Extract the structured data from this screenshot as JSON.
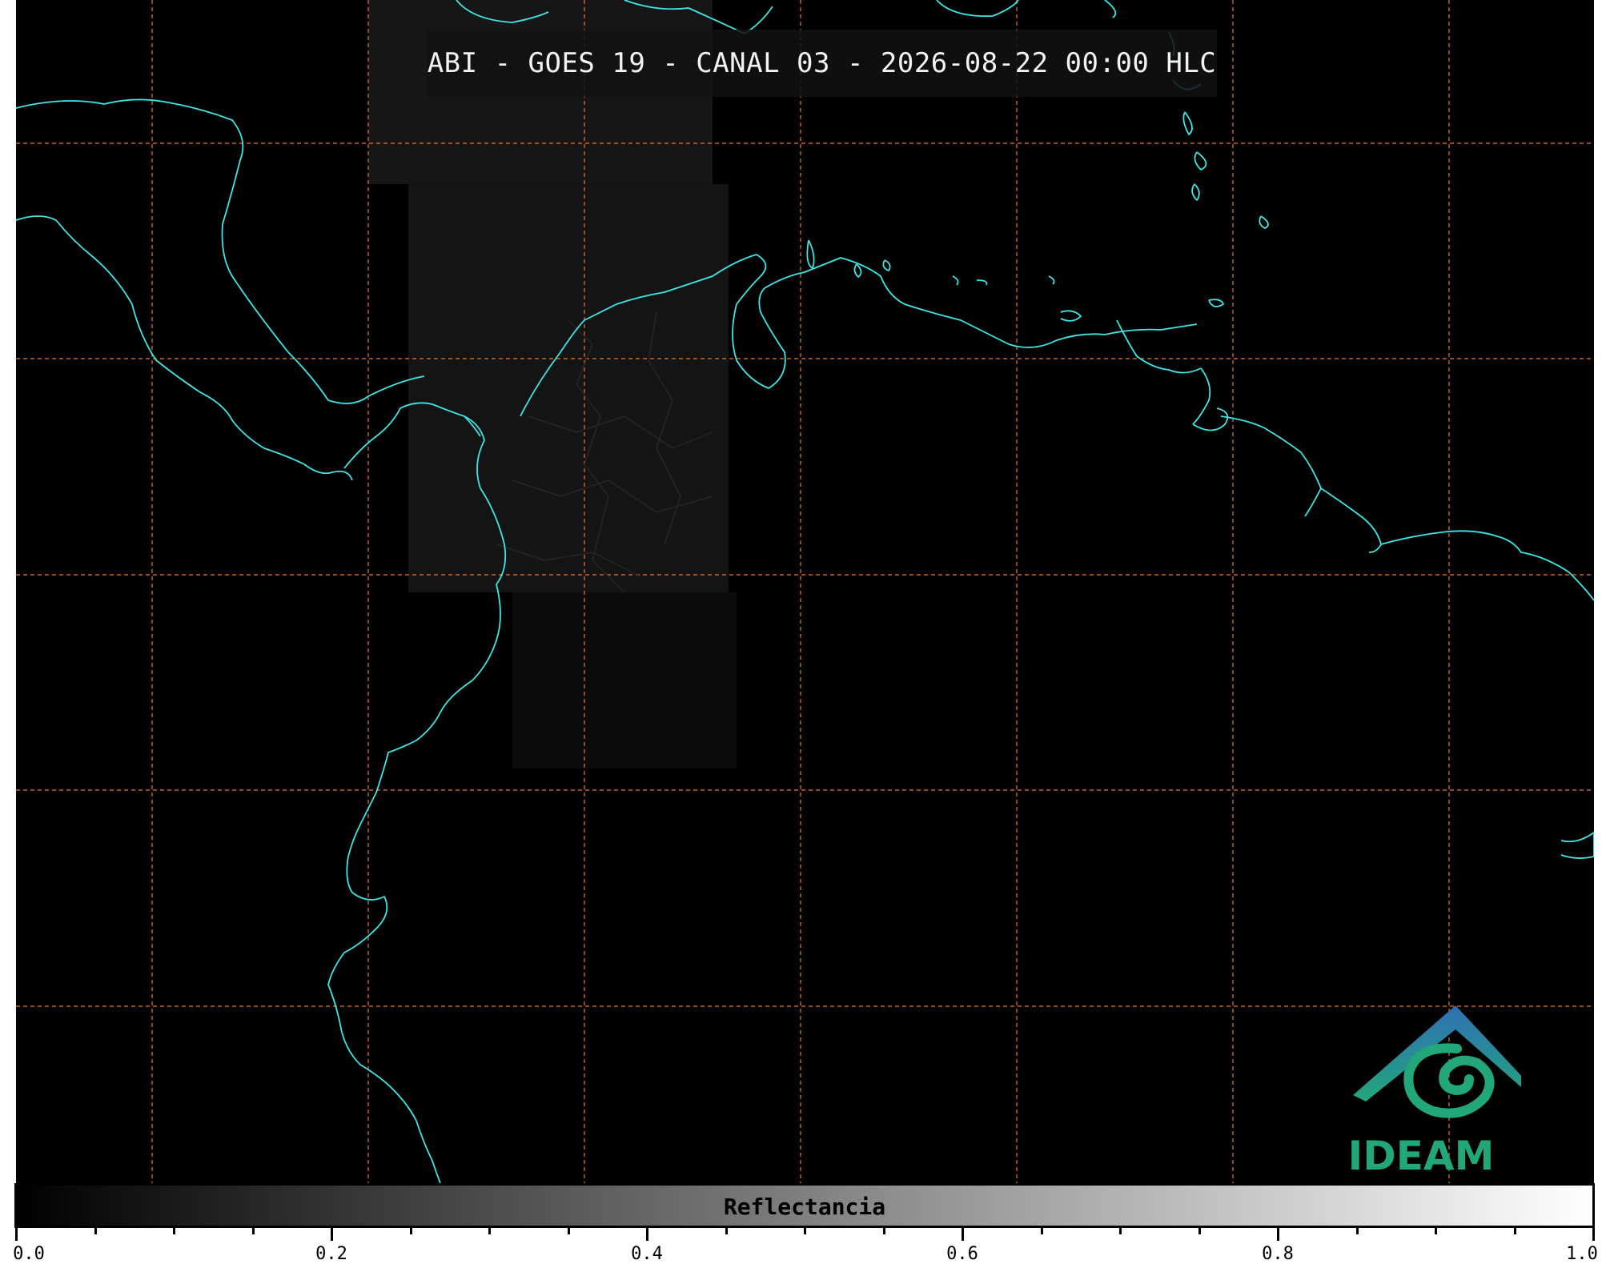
{
  "title": "ABI - GOES 19 - CANAL 03 - 2026-08-22 00:00 HLC",
  "colorbar": {
    "label": "Reflectancia",
    "min": 0.0,
    "max": 1.0,
    "tick_labels": [
      "0.0",
      "0.2",
      "0.4",
      "0.6",
      "0.8",
      "1.0"
    ],
    "colormap": [
      "#000000",
      "#ffffff"
    ]
  },
  "logo": {
    "text": "IDEAM"
  },
  "colors": {
    "background": "#000000",
    "coastline": "#3ee6e6",
    "gridlines": "#c8662a",
    "logo_green": "#22a77a",
    "logo_blue": "#2f6fb5"
  },
  "map": {
    "gridlines": "dashed",
    "grid_color_name": "orange"
  }
}
